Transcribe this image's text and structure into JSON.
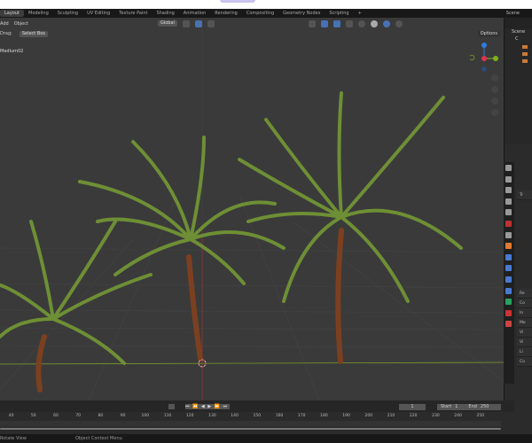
{
  "workspace_tabs": [
    "Layout",
    "Modeling",
    "Sculpting",
    "UV Editing",
    "Texture Paint",
    "Shading",
    "Animation",
    "Rendering",
    "Compositing",
    "Geometry Nodes",
    "Scripting",
    "+"
  ],
  "active_tab": "Layout",
  "scene_label": "Scene",
  "viewport": {
    "menu": [
      "Add",
      "Object"
    ],
    "drag_label": "Drag:",
    "select_mode": "Select Box",
    "transform_orientation": "Global",
    "options_label": "Options",
    "object_name": "Medium02",
    "gizmo": {
      "z": "Z",
      "x": "X",
      "y": "Y"
    }
  },
  "outliner": {
    "items": [
      "Scene",
      "C"
    ]
  },
  "properties": {
    "sections": [
      "Tr",
      "Re",
      "Co",
      "In",
      "Mo",
      "Vi",
      "Vi",
      "Li",
      "Co"
    ]
  },
  "timeline": {
    "current_frame": "1",
    "start_label": "Start",
    "start": "1",
    "end_label": "End",
    "end": "250",
    "ticks": [
      "40",
      "50",
      "60",
      "70",
      "80",
      "90",
      "100",
      "110",
      "120",
      "130",
      "140",
      "150",
      "160",
      "170",
      "180",
      "190",
      "200",
      "210",
      "220",
      "230",
      "240",
      "250"
    ]
  },
  "status": {
    "left": "Rotate View",
    "middle": "Object Context Menu"
  },
  "colors": {
    "accent": "#4772b3",
    "x_axis": "#e0344e",
    "y_axis": "#7cb319",
    "z_axis": "#2d7ce0",
    "frond": "#6e8f35",
    "trunk": "#8a4a26"
  }
}
